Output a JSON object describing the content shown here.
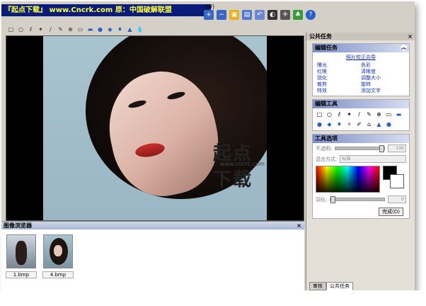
{
  "banner": {
    "text": "『起点下载』 www.Cncrk.com 原：中国破解联盟"
  },
  "menu": {
    "help_fragment": "(W)"
  },
  "colors": {
    "banner_bg": "#0a1c7a",
    "banner_text": "#ffff40",
    "link": "#1633a8",
    "section_header": "#7c90c8"
  },
  "toolbar_top": {
    "icons": [
      "zoom-in-icon",
      "zoom-out-icon",
      "image-icon",
      "layers-icon",
      "undo-icon",
      "contrast-icon",
      "crosshair-icon",
      "sticker-icon",
      "help-icon"
    ]
  },
  "toolbar_tools": {
    "icons": [
      "select-rect-icon",
      "select-ellipse-icon",
      "lasso-icon",
      "magic-wand-icon",
      "brush-icon",
      "pencil-icon",
      "clone-icon",
      "eraser-icon",
      "shape-icon",
      "fill-icon",
      "text-icon",
      "blur-icon",
      "sharpen-icon",
      "dodge-icon"
    ]
  },
  "canvas": {
    "watermark": "起点下载",
    "watermark_sub": "www.cncrk.com"
  },
  "browser": {
    "title": "图像浏览器",
    "close": "×",
    "thumbnails": [
      {
        "name": "1.bmp"
      },
      {
        "name": "4.bmp"
      }
    ]
  },
  "panel": {
    "title": "公共任务",
    "close": "×",
    "edit_tasks": {
      "header": "编辑任务",
      "wizard": "照片校正向导",
      "links_left": [
        "曝光",
        "红眼",
        "锐化",
        "裁剪",
        "特效"
      ],
      "links_right": [
        "色彩",
        "清晰度",
        "调整大小",
        "旋转",
        "添加文字"
      ]
    },
    "edit_tools": {
      "header": "编辑工具"
    },
    "tool_options": {
      "header": "工具选项",
      "opacity_label": "不透明:",
      "opacity_value": "100",
      "blend_label": "混合方式:",
      "blend_value": "标准",
      "radius_label": "羽化:",
      "radius_value": "0",
      "done_button": "完成(D)"
    },
    "tabs": [
      "审核",
      "公共任务"
    ]
  }
}
